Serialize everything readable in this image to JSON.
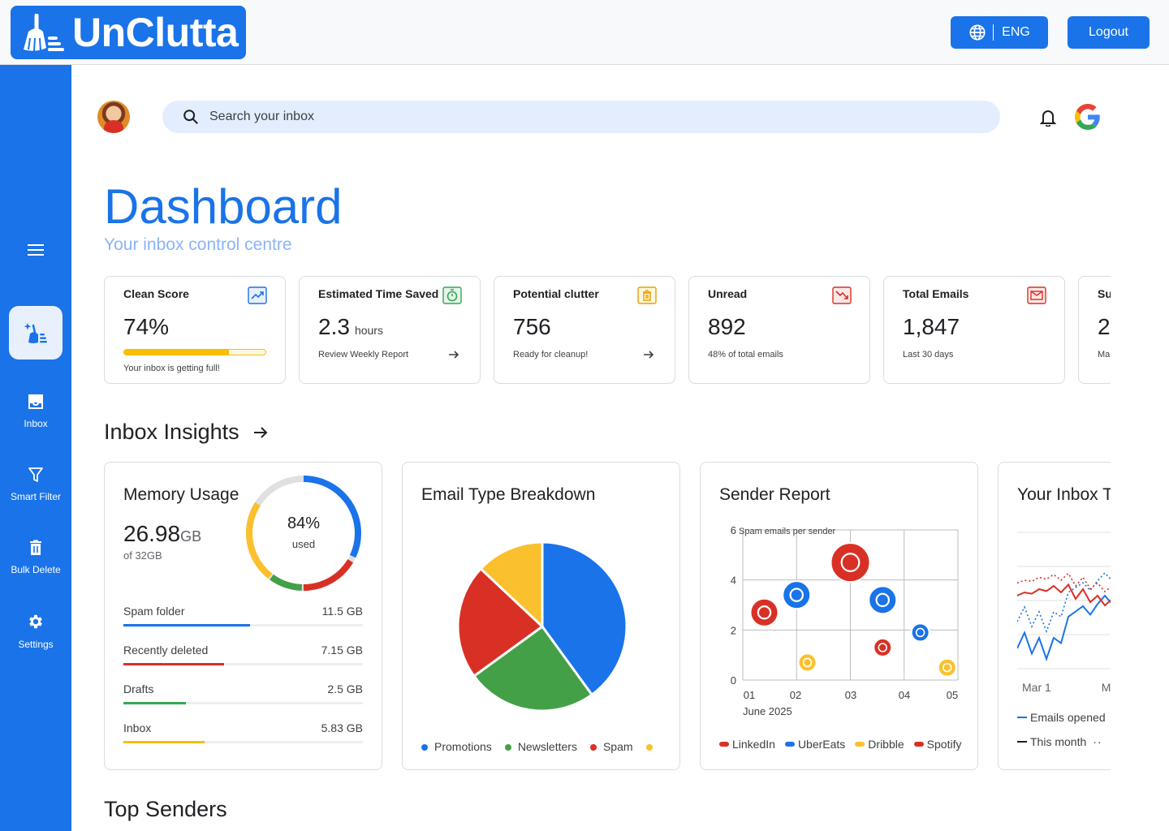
{
  "app": {
    "name": "UnClutta",
    "language_label": "ENG",
    "logout_label": "Logout"
  },
  "sidebar": {
    "items": [
      {
        "label": "Inbox"
      },
      {
        "label": "Smart Filter"
      },
      {
        "label": "Bulk Delete"
      },
      {
        "label": "Settings"
      }
    ]
  },
  "search": {
    "placeholder": "Search your inbox"
  },
  "page": {
    "title": "Dashboard",
    "subtitle": "Your inbox control centre"
  },
  "stats": [
    {
      "label": "Clean Score",
      "value": "74%",
      "sub": "Your inbox is getting full!",
      "progress": 0.74,
      "icon": "chart-line-icon",
      "color": "#1a73e8"
    },
    {
      "label": "Estimated Time Saved",
      "value": "2.3",
      "unit": "hours",
      "sub": "Review Weekly Report",
      "icon": "stopwatch-icon",
      "color": "#34a853"
    },
    {
      "label": "Potential clutter",
      "value": "756",
      "sub": "Ready for cleanup!",
      "icon": "trash-icon",
      "color": "#e8a000"
    },
    {
      "label": "Unread",
      "value": "892",
      "sub": "48% of total emails",
      "icon": "trend-down-icon",
      "color": "#d93025"
    },
    {
      "label": "Total Emails",
      "value": "1,847",
      "sub": "Last 30 days",
      "icon": "mail-icon",
      "color": "#d93025"
    },
    {
      "label": "Su",
      "value": "2",
      "sub": "Ma"
    }
  ],
  "insights": {
    "heading": "Inbox Insights",
    "memory": {
      "title": "Memory Usage",
      "used": "26.98",
      "used_unit": "GB",
      "of": "of 32GB",
      "percent_label": "84%",
      "percent_sub": "used",
      "rows": [
        {
          "label": "Spam folder",
          "value": "11.5 GB",
          "fraction": 0.53,
          "color": "#1a73e8"
        },
        {
          "label": "Recently deleted",
          "value": "7.15 GB",
          "fraction": 0.42,
          "color": "#d93025"
        },
        {
          "label": "Drafts",
          "value": "2.5 GB",
          "fraction": 0.26,
          "color": "#34a853"
        },
        {
          "label": "Inbox",
          "value": "5.83 GB",
          "fraction": 0.34,
          "color": "#fbbc04"
        }
      ]
    },
    "breakdown": {
      "title": "Email Type Breakdown",
      "legend": [
        "Promotions",
        "Newsletters",
        "Spam",
        ""
      ]
    },
    "sender": {
      "title": "Sender Report",
      "legend": [
        "LinkedIn",
        "UberEats",
        "Dribble",
        "Spotify"
      ]
    },
    "trend": {
      "title": "Your Inbox T",
      "x_first": "Mar 1",
      "x_second": "M",
      "legend": [
        "Emails opened",
        "This month"
      ]
    }
  },
  "chart_data": [
    {
      "type": "pie",
      "title": "Email Type Breakdown",
      "categories": [
        "Promotions",
        "Newsletters",
        "Spam",
        ""
      ],
      "values": [
        40,
        25,
        22,
        13
      ],
      "colors": [
        "#1a73e8",
        "#43a047",
        "#d93025",
        "#fbc02d"
      ]
    },
    {
      "type": "scatter",
      "title": "Sender Report",
      "ylabel": "Spam emails per sender",
      "xlabel": "June 2025",
      "x_ticks": [
        "01",
        "02",
        "03",
        "04",
        "05"
      ],
      "y_ticks": [
        "0",
        "2",
        "4",
        "6"
      ],
      "ylim": [
        0,
        6
      ],
      "series": [
        {
          "name": "LinkedIn",
          "x": [
            3
          ],
          "y": [
            4.7
          ],
          "size": "large",
          "color": "#d93025",
          "icon": "linkedin-icon"
        },
        {
          "name": "UberEats",
          "x": [
            2
          ],
          "y": [
            3.4
          ],
          "size": "medium",
          "color": "#1a73e8",
          "icon": "ubereats-icon"
        },
        {
          "name": "Dribble",
          "x": [
            2.2,
            4.8
          ],
          "y": [
            0.7,
            0.5
          ],
          "size": "small",
          "color": "#fbc02d",
          "icon": "dribbble-icon"
        },
        {
          "name": "Spotify",
          "x": [
            3.6
          ],
          "y": [
            1.3
          ],
          "size": "small",
          "color": "#d93025",
          "icon": "spotify-icon"
        },
        {
          "name": "",
          "x": [
            1.4
          ],
          "y": [
            2.7
          ],
          "size": "medium",
          "color": "#d93025",
          "icon": "github-icon"
        },
        {
          "name": "",
          "x": [
            3.6
          ],
          "y": [
            3.2
          ],
          "size": "medium",
          "color": "#1a73e8",
          "icon": "airbnb-icon"
        },
        {
          "name": "",
          "x": [
            4.3
          ],
          "y": [
            1.9
          ],
          "size": "small",
          "color": "#1a73e8",
          "icon": "figma-icon"
        }
      ]
    },
    {
      "type": "line",
      "title": "Your Inbox T",
      "x": [
        "Mar 1",
        "M"
      ],
      "series": [
        {
          "name": "Emails opened",
          "color": "#1a73e8",
          "values": [
            0.2,
            0.35,
            0.15,
            0.3,
            0.1,
            0.3,
            0.25,
            0.5,
            0.55,
            0.6,
            0.52,
            0.62,
            0.7,
            0.62
          ]
        },
        {
          "name": "This month",
          "color": "#1f1f1f"
        }
      ]
    }
  ],
  "top_senders": {
    "heading": "Top Senders"
  }
}
